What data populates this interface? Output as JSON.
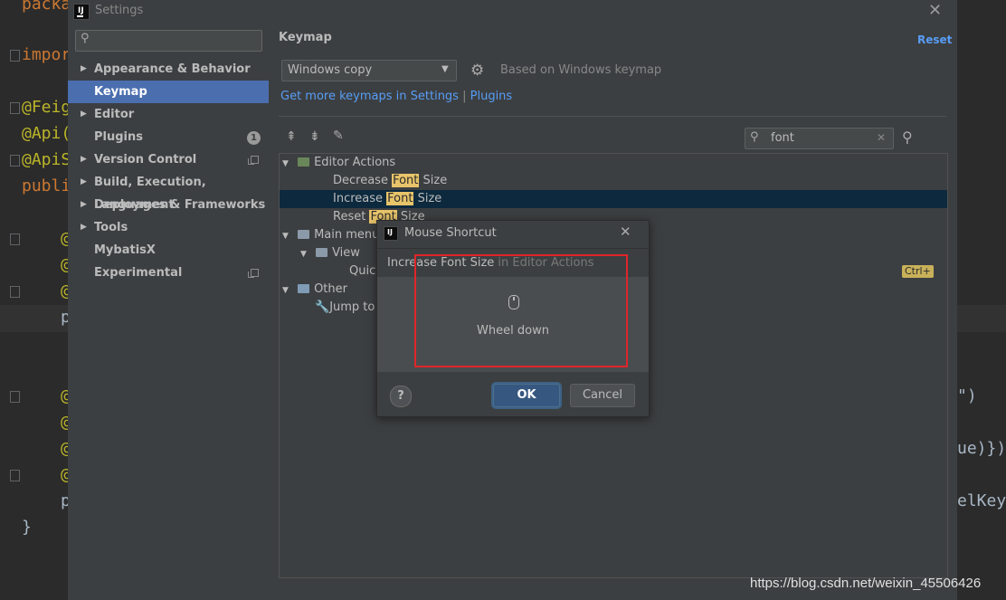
{
  "editor": {
    "lines": [
      "packa",
      "impor",
      "@Feig",
      "@Api(",
      "@ApiS",
      "publi",
      "@",
      "@",
      "@",
      "p",
      "@",
      "@",
      "@",
      "@",
      "p",
      "}"
    ],
    "right_fragments": [
      "\")",
      "ue)})",
      "elKey"
    ]
  },
  "settings": {
    "title": "Settings",
    "search_placeholder": "",
    "sidebar": [
      {
        "label": "Appearance & Behavior",
        "expandable": true
      },
      {
        "label": "Keymap",
        "expandable": false,
        "selected": true
      },
      {
        "label": "Editor",
        "expandable": true
      },
      {
        "label": "Plugins",
        "expandable": false,
        "badge": "1"
      },
      {
        "label": "Version Control",
        "expandable": true
      },
      {
        "label": "Build, Execution, Deployment",
        "expandable": true
      },
      {
        "label": "Languages & Frameworks",
        "expandable": true
      },
      {
        "label": "Tools",
        "expandable": true
      },
      {
        "label": "MybatisX",
        "expandable": false
      },
      {
        "label": "Experimental",
        "expandable": false
      }
    ],
    "main": {
      "heading": "Keymap",
      "reset": "Reset",
      "keymap_select": "Windows copy",
      "based_on": "Based on Windows keymap",
      "link_more": "Get more keymaps in Settings",
      "link_sep": " | ",
      "link_plugins": "Plugins",
      "filter_value": "font",
      "tree": {
        "editor_actions": "Editor Actions",
        "decrease_pre": "Decrease ",
        "decrease_mid": "Font",
        "decrease_post": " Size",
        "increase_pre": "Increase ",
        "increase_mid": "Font",
        "increase_post": " Size",
        "reset_pre": "Reset ",
        "reset_mid": "Font",
        "reset_post": " Size",
        "main_menu": "Main menu",
        "view": "View",
        "quick": "Quick",
        "other": "Other",
        "jump_to": "Jump to",
        "shortcut_badge": "Ctrl+"
      }
    }
  },
  "mouse_dialog": {
    "title": "Mouse Shortcut",
    "action": "Increase Font Size",
    "context": " in Editor Actions",
    "gesture": "Wheel down",
    "ok": "OK",
    "cancel": "Cancel",
    "help": "?"
  },
  "watermark": "https://blog.csdn.net/weixin_45506426",
  "colors": {
    "accent": "#4b6eaf",
    "link": "#589df6",
    "highlight": "#e8c46a",
    "annotation_box": "#e0252a"
  }
}
